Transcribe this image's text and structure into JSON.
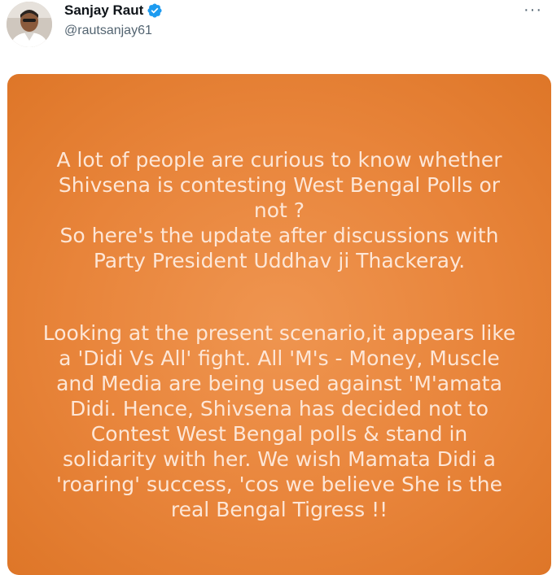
{
  "tweet": {
    "author": {
      "display_name": "Sanjay Raut",
      "handle": "@rautsanjay61",
      "verified": true,
      "avatar_icon": "profile-photo"
    },
    "more_icon": "ellipsis-icon",
    "image_text": {
      "paragraph1": "A lot of people are curious to know whether\nShivsena is contesting West Bengal Polls or\nnot ?\nSo here's the update after  discussions with\nParty President Uddhav ji Thackeray.",
      "paragraph2": "Looking at the present scenario,it appears like\na 'Didi Vs All' fight. All 'M's - Money, Muscle\nand Media are being used against  'M'amata\nDidi. Hence, Shivsena has decided not to\nContest West Bengal polls & stand in\nsolidarity with her. We wish Mamata Didi a\n'roaring' success, 'cos we believe She is the\nreal Bengal Tigress !!"
    },
    "colors": {
      "image_background": "#e8843a",
      "image_text": "#fde6d6",
      "verified_badge": "#1d9bf0"
    }
  }
}
